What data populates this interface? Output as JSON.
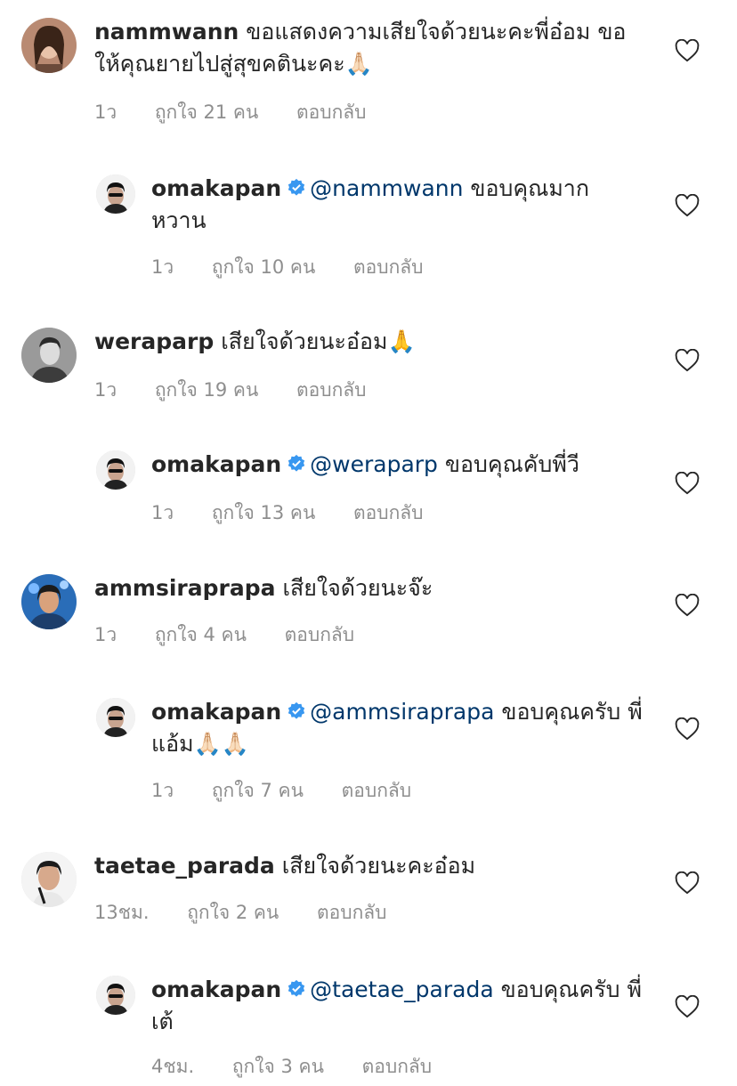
{
  "icons": {
    "heart": "heart-outline-icon",
    "verified": "verified-badge-icon"
  },
  "colors": {
    "mention": "#00376b",
    "meta": "#8e8e8e",
    "verified": "#3897f0"
  },
  "comments": [
    {
      "username": "nammwann",
      "text": "ขอแสดงความเสียใจด้วยนะคะพี่อ๋อม ขอให้คุณยายไปสู่สุขคตินะคะ🙏🏻",
      "time": "1ว",
      "likes": "ถูกใจ 21 คน",
      "reply_label": "ตอบกลับ",
      "reply": {
        "username": "omakapan",
        "mention": "@nammwann",
        "text": " ขอบคุณมาก หวาน",
        "time": "1ว",
        "likes": "ถูกใจ 10 คน",
        "reply_label": "ตอบกลับ"
      }
    },
    {
      "username": "weraparp",
      "text": "เสียใจด้วยนะอ๋อม🙏",
      "time": "1ว",
      "likes": "ถูกใจ 19 คน",
      "reply_label": "ตอบกลับ",
      "reply": {
        "username": "omakapan",
        "mention": "@weraparp",
        "text": " ขอบคุณคับพี่วี",
        "time": "1ว",
        "likes": "ถูกใจ 13 คน",
        "reply_label": "ตอบกลับ"
      }
    },
    {
      "username": "ammsiraprapa",
      "text": "เสียใจด้วยนะจ๊ะ",
      "time": "1ว",
      "likes": "ถูกใจ 4 คน",
      "reply_label": "ตอบกลับ",
      "reply": {
        "username": "omakapan",
        "mention": "@ammsiraprapa",
        "text": " ขอบคุณครับ พี่แอ้ม🙏🏻🙏🏻",
        "time": "1ว",
        "likes": "ถูกใจ 7 คน",
        "reply_label": "ตอบกลับ"
      }
    },
    {
      "username": "taetae_parada",
      "text": "เสียใจด้วยนะคะอ๋อม",
      "time": "13ชม.",
      "likes": "ถูกใจ 2 คน",
      "reply_label": "ตอบกลับ",
      "reply": {
        "username": "omakapan",
        "mention": "@taetae_parada",
        "text": " ขอบคุณครับ พี่เต้",
        "time": "4ชม.",
        "likes": "ถูกใจ 3 คน",
        "reply_label": "ตอบกลับ"
      }
    }
  ]
}
